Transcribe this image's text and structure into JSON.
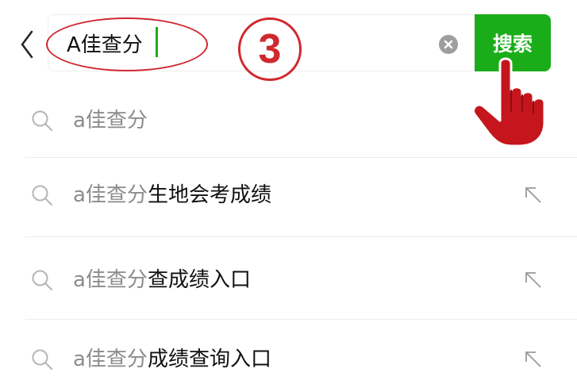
{
  "search": {
    "query": "A佳查分",
    "button_label": "搜索"
  },
  "annotation": {
    "step_number": "3",
    "color": "#d0282f"
  },
  "colors": {
    "accent": "#1aad19",
    "match_text": "#8c8c8c",
    "main_text": "#111111"
  },
  "icons": {
    "back": "chevron-left-icon",
    "clear": "clear-icon",
    "search": "search-icon",
    "fill_query": "arrow-up-left-icon",
    "pointer": "hand-pointer-icon"
  },
  "suggestions": [
    {
      "match": "a佳查分",
      "rest": "",
      "has_fill_arrow": false
    },
    {
      "match": "a佳查分",
      "rest": "生地会考成绩",
      "has_fill_arrow": true
    },
    {
      "match": "a佳查分",
      "rest": "查成绩入口",
      "has_fill_arrow": true
    },
    {
      "match": "a佳查分",
      "rest": "成绩查询入口",
      "has_fill_arrow": true
    }
  ]
}
